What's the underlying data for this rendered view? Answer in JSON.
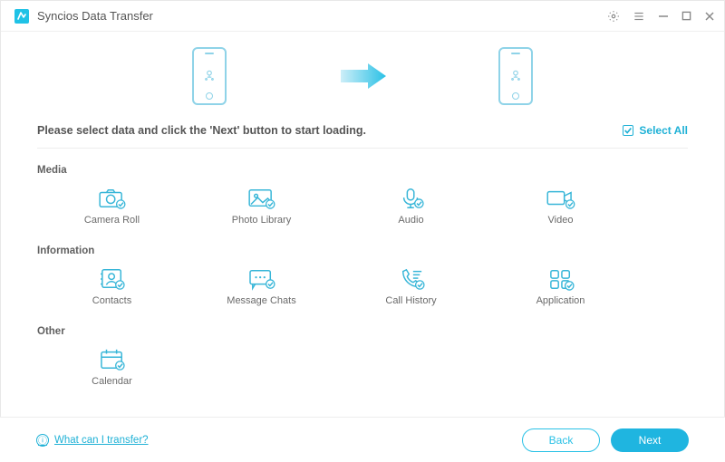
{
  "app": {
    "title": "Syncios Data Transfer"
  },
  "instruction": "Please select data and click the 'Next' button to start loading.",
  "select_all": {
    "label": "Select All",
    "checked": true
  },
  "sections": {
    "media": {
      "title": "Media",
      "items": [
        {
          "label": "Camera Roll"
        },
        {
          "label": "Photo Library"
        },
        {
          "label": "Audio"
        },
        {
          "label": "Video"
        }
      ]
    },
    "information": {
      "title": "Information",
      "items": [
        {
          "label": "Contacts"
        },
        {
          "label": "Message Chats"
        },
        {
          "label": "Call History"
        },
        {
          "label": "Application"
        }
      ]
    },
    "other": {
      "title": "Other",
      "items": [
        {
          "label": "Calendar"
        }
      ]
    }
  },
  "footer": {
    "help_label": "What can I transfer?",
    "back_label": "Back",
    "next_label": "Next"
  },
  "colors": {
    "accent": "#1fb5e0",
    "icon": "#38b6d8"
  }
}
